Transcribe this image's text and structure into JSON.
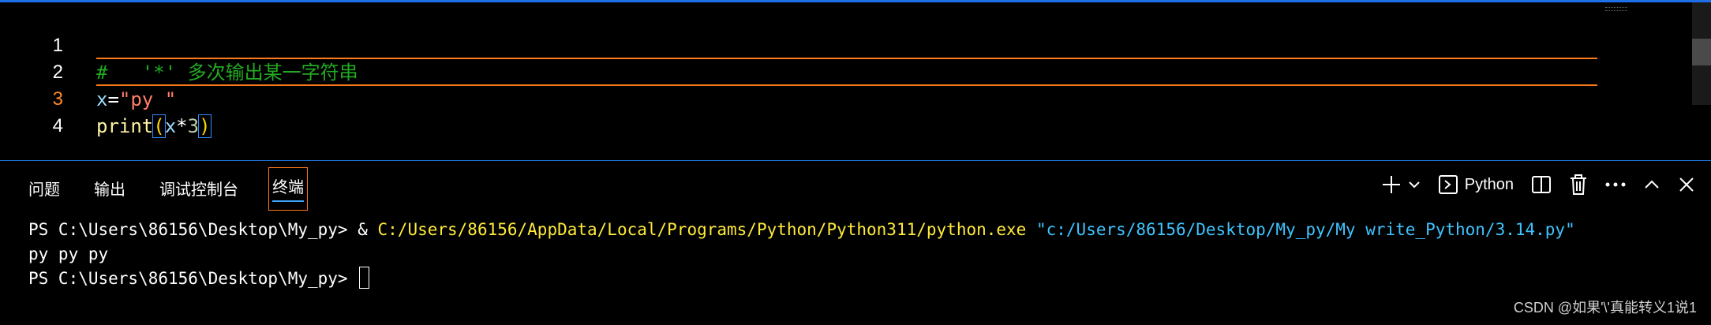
{
  "editor": {
    "lines": [
      {
        "number": "1",
        "text": "#   '*' 多次输出某一字符串"
      },
      {
        "number": "2",
        "var": "x",
        "op": "=",
        "str": "\"py \""
      },
      {
        "number": "3",
        "fn": "print",
        "open": "(",
        "arg_var": "x",
        "arg_op": "*",
        "arg_num": "3",
        "close": ")"
      },
      {
        "number": "4",
        "text": ""
      }
    ]
  },
  "panel": {
    "tabs": [
      "问题",
      "输出",
      "调试控制台",
      "终端"
    ],
    "active_tab": "终端",
    "actions": {
      "add": "plus-icon",
      "dropdown": "chevron-down-icon",
      "shell_label": "Python",
      "split": "split-icon",
      "trash": "trash-icon",
      "more": "more-icon",
      "maximize": "chevron-up-icon",
      "close": "close-icon"
    }
  },
  "terminal": {
    "line1_prompt": "PS C:\\Users\\86156\\Desktop\\My_py> & ",
    "line1_exe": "C:/Users/86156/AppData/Local/Programs/Python/Python311/python.exe",
    "line1_space": " ",
    "line1_arg": "\"c:/Users/86156/Desktop/My_py/My write_Python/3.14.py\"",
    "line2": "py py py ",
    "line3_prompt": "PS C:\\Users\\86156\\Desktop\\My_py> "
  },
  "watermark": "CSDN @如果'\\'真能转义1说1",
  "colors": {
    "accent_orange": "#ff7a1a",
    "accent_blue": "#1f6feb",
    "comment": "#22aa22",
    "string": "#ff7e6b",
    "terminal_path": "#ffea3a",
    "terminal_string": "#3fc4ff"
  }
}
